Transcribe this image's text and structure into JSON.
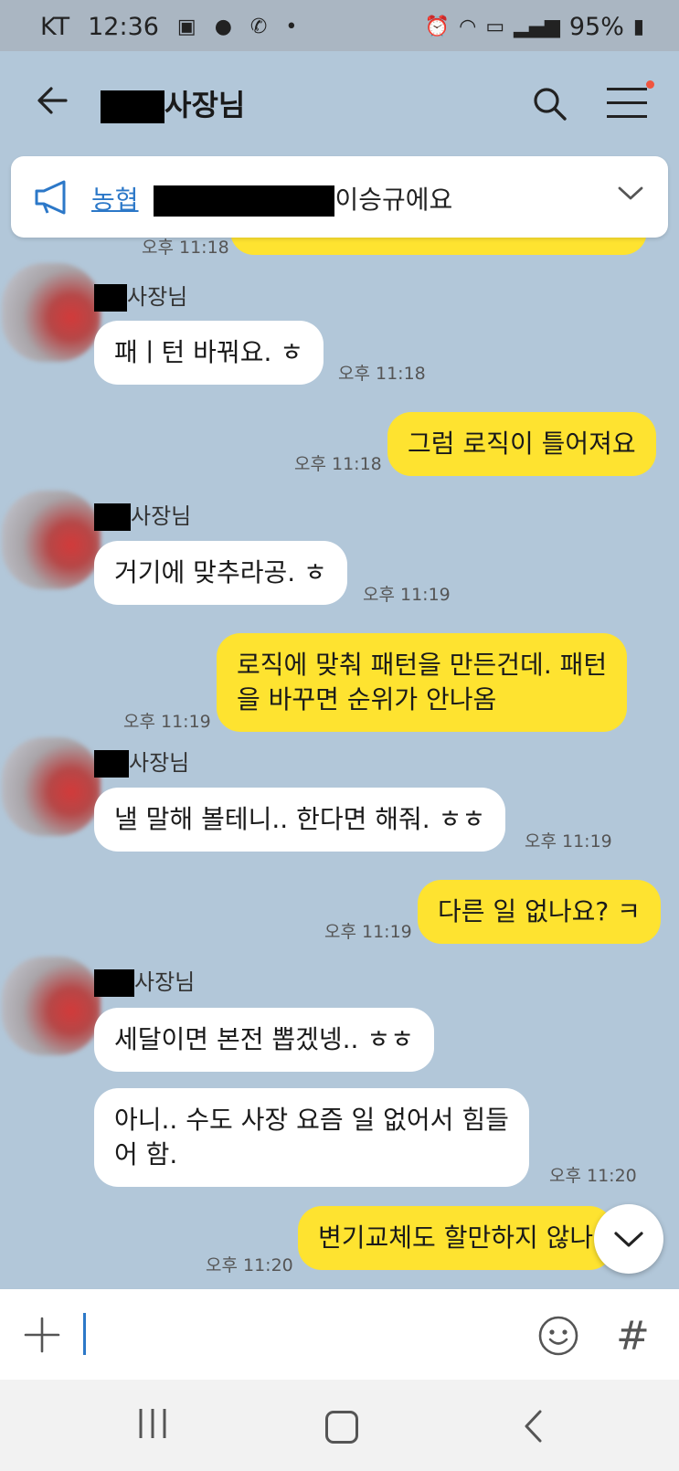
{
  "status_bar": {
    "carrier": "KT",
    "time": "12:36",
    "battery": "95%",
    "icons": [
      "image-icon",
      "talk-icon",
      "call-icon",
      "dot-icon",
      "alarm-icon",
      "wifi-icon",
      "hd-icon",
      "signal-icon",
      "battery-icon"
    ]
  },
  "header": {
    "title": "사장님"
  },
  "notice": {
    "link_text": "농협",
    "text": "이승규에요"
  },
  "messages": [
    {
      "direction": "out",
      "text": "",
      "time": "오후 11:18"
    },
    {
      "direction": "in",
      "sender": "사장님",
      "text": "패ㅣ턴 바꿔요. ㅎ",
      "time": "오후 11:18"
    },
    {
      "direction": "out",
      "text": "그럼 로직이 틀어져요",
      "time": "오후 11:18"
    },
    {
      "direction": "in",
      "sender": "사장님",
      "text": "거기에 맞추라공. ㅎ",
      "time": "오후 11:19"
    },
    {
      "direction": "out",
      "line1": "로직에 맞춰 패턴을 만든건데. 패턴",
      "line2": "을 바꾸면 순위가 안나옴",
      "time": "오후 11:19"
    },
    {
      "direction": "in",
      "sender": "사장님",
      "text": "낼 말해 볼테니.. 한다면 해줘. ㅎㅎ",
      "time": "오후 11:19"
    },
    {
      "direction": "out",
      "text": "다른 일 없나요? ㅋ",
      "time": "오후 11:19"
    },
    {
      "direction": "in",
      "sender": "사장님",
      "text": "세달이면 본전 뽑겠넹.. ㅎㅎ"
    },
    {
      "direction": "in",
      "line1": "아니.. 수도 사장 요즘 일 없어서 힘들",
      "line2": "어 함.",
      "time": "오후 11:20"
    },
    {
      "direction": "out",
      "text": "변기교체도 할만하지 않나",
      "time": "오후 11:20"
    }
  ],
  "colors": {
    "chat_bg": "#b2c7d9",
    "outgoing_bubble": "#fee330",
    "incoming_bubble": "#ffffff",
    "link": "#2c78c8"
  }
}
